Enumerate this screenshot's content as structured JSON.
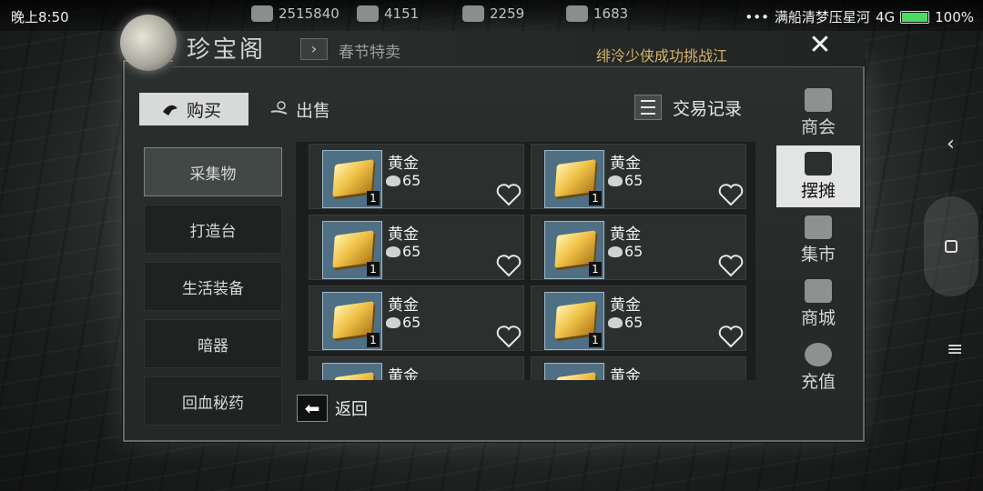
{
  "status_bar": {
    "time": "晚上8:50",
    "resources": [
      {
        "icon": "film-reel-icon",
        "value": "2515840"
      },
      {
        "icon": "silver-ingot-icon",
        "value": "4151"
      },
      {
        "icon": "jade-icon",
        "value": "2259"
      },
      {
        "icon": "gold-ingot-icon",
        "value": "1683"
      }
    ],
    "carrier": "满船清梦压星河",
    "network": "4G",
    "battery": "100%"
  },
  "header": {
    "title": "珍宝阁",
    "breadcrumb": "春节特卖",
    "marquee": "绯泠少侠成功挑战江",
    "close_label": "✕"
  },
  "tabs": {
    "buy": "购买",
    "sell": "出售",
    "trade_log": "交易记录"
  },
  "categories": [
    "采集物",
    "打造台",
    "生活装备",
    "暗器",
    "回血秘药"
  ],
  "items": [
    {
      "name": "黄金",
      "price": "65",
      "qty": "1"
    },
    {
      "name": "黄金",
      "price": "65",
      "qty": "1"
    },
    {
      "name": "黄金",
      "price": "65",
      "qty": "1"
    },
    {
      "name": "黄金",
      "price": "65",
      "qty": "1"
    },
    {
      "name": "黄金",
      "price": "65",
      "qty": "1"
    },
    {
      "name": "黄金",
      "price": "65",
      "qty": "1"
    },
    {
      "name": "黄金",
      "price": "",
      "qty": ""
    },
    {
      "name": "黄金",
      "price": "",
      "qty": ""
    }
  ],
  "back_label": "返回",
  "right_nav": [
    {
      "label": "商会",
      "icon": "emblem-icon"
    },
    {
      "label": "摆摊",
      "icon": "stall-icon"
    },
    {
      "label": "集市",
      "icon": "market-icon"
    },
    {
      "label": "商城",
      "icon": "shop-icon"
    },
    {
      "label": "充值",
      "icon": "money-bag-icon"
    }
  ],
  "colors": {
    "accent_gold": "#d7b46a",
    "active_tab": "#d8dad9"
  }
}
